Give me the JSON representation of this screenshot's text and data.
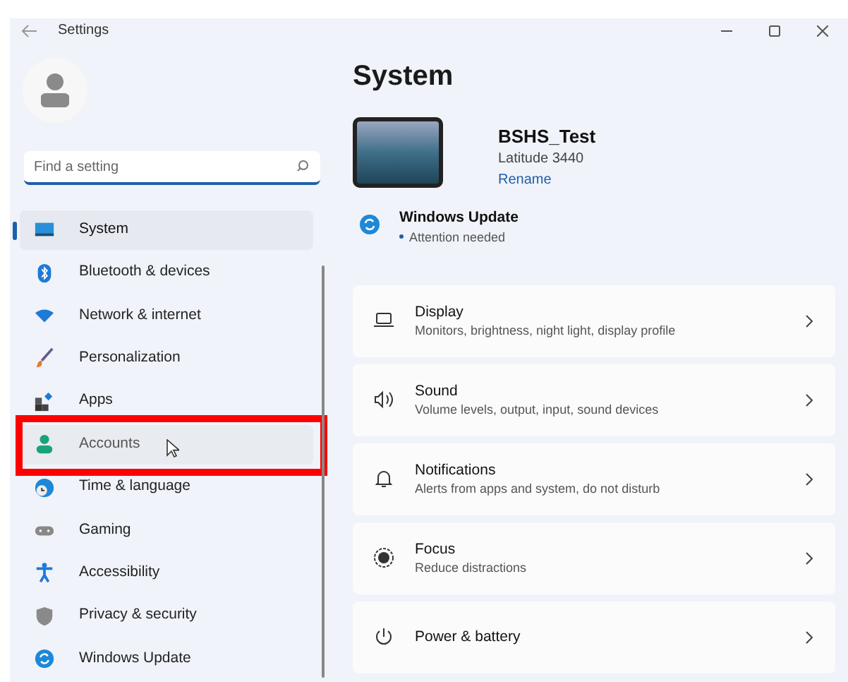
{
  "window": {
    "title": "Settings"
  },
  "search": {
    "placeholder": "Find a setting"
  },
  "sidebar": {
    "items": [
      {
        "label": "System",
        "selected": true,
        "hovered": false,
        "annotated": false
      },
      {
        "label": "Bluetooth & devices",
        "selected": false,
        "hovered": false,
        "annotated": false
      },
      {
        "label": "Network & internet",
        "selected": false,
        "hovered": false,
        "annotated": false
      },
      {
        "label": "Personalization",
        "selected": false,
        "hovered": false,
        "annotated": false
      },
      {
        "label": "Apps",
        "selected": false,
        "hovered": false,
        "annotated": false
      },
      {
        "label": "Accounts",
        "selected": false,
        "hovered": true,
        "annotated": true
      },
      {
        "label": "Time & language",
        "selected": false,
        "hovered": false,
        "annotated": false
      },
      {
        "label": "Gaming",
        "selected": false,
        "hovered": false,
        "annotated": false
      },
      {
        "label": "Accessibility",
        "selected": false,
        "hovered": false,
        "annotated": false
      },
      {
        "label": "Privacy & security",
        "selected": false,
        "hovered": false,
        "annotated": false
      },
      {
        "label": "Windows Update",
        "selected": false,
        "hovered": false,
        "annotated": false
      }
    ]
  },
  "page": {
    "title": "System"
  },
  "device": {
    "name": "BSHS_Test",
    "model": "Latitude 3440",
    "rename": "Rename"
  },
  "update": {
    "title": "Windows Update",
    "status": "Attention needed"
  },
  "cards": [
    {
      "title": "Display",
      "subtitle": "Monitors, brightness, night light, display profile"
    },
    {
      "title": "Sound",
      "subtitle": "Volume levels, output, input, sound devices"
    },
    {
      "title": "Notifications",
      "subtitle": "Alerts from apps and system, do not disturb"
    },
    {
      "title": "Focus",
      "subtitle": "Reduce distractions"
    },
    {
      "title": "Power & battery"
    }
  ]
}
